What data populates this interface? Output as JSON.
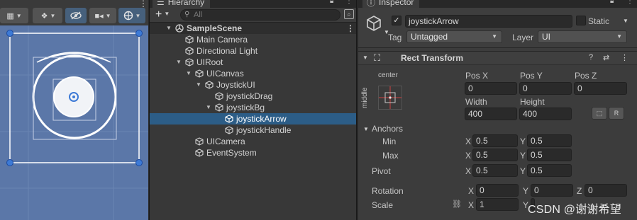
{
  "scene_toolbar": {
    "buttons": [
      "draw-mode",
      "fx",
      "gizmos",
      "visibility",
      "camera",
      "tools"
    ],
    "colors": {
      "bg": "#5b77a8",
      "handle": "#3d7ad6"
    }
  },
  "hierarchy": {
    "tab_title": "Hierarchy",
    "add_label": "+",
    "search_placeholder": "All",
    "items": [
      {
        "label": "SampleScene",
        "depth": 0,
        "icon": "unity-scene-icon",
        "expanded": true
      },
      {
        "label": "Main Camera",
        "depth": 1,
        "icon": "gameobject-icon"
      },
      {
        "label": "Directional Light",
        "depth": 1,
        "icon": "gameobject-icon"
      },
      {
        "label": "UIRoot",
        "depth": 1,
        "icon": "gameobject-icon",
        "expanded": true
      },
      {
        "label": "UICanvas",
        "depth": 2,
        "icon": "gameobject-icon",
        "expanded": true
      },
      {
        "label": "JoystickUI",
        "depth": 3,
        "icon": "gameobject-icon",
        "expanded": true
      },
      {
        "label": "joystickDrag",
        "depth": 4,
        "icon": "gameobject-icon"
      },
      {
        "label": "joystickBg",
        "depth": 4,
        "icon": "gameobject-icon",
        "expanded": true
      },
      {
        "label": "joystickArrow",
        "depth": 5,
        "icon": "gameobject-icon",
        "selected": true
      },
      {
        "label": "joystickHandle",
        "depth": 5,
        "icon": "gameobject-icon"
      },
      {
        "label": "UICamera",
        "depth": 2,
        "icon": "gameobject-icon"
      },
      {
        "label": "EventSystem",
        "depth": 2,
        "icon": "gameobject-icon"
      }
    ]
  },
  "inspector": {
    "tab_title": "Inspector",
    "object_name": "joystickArrow",
    "static_label": "Static",
    "tag_label": "Tag",
    "tag_value": "Untagged",
    "layer_label": "Layer",
    "layer_value": "UI",
    "component_title": "Rect Transform",
    "anchor_h": "center",
    "anchor_v": "middle",
    "pos_x_label": "Pos X",
    "pos_y_label": "Pos Y",
    "pos_z_label": "Pos Z",
    "pos_x": "0",
    "pos_y": "0",
    "pos_z": "0",
    "width_label": "Width",
    "height_label": "Height",
    "width": "400",
    "height": "400",
    "r_label": "R",
    "anchors_label": "Anchors",
    "min_label": "Min",
    "max_label": "Max",
    "min_x": "0.5",
    "min_y": "0.5",
    "max_x": "0.5",
    "max_y": "0.5",
    "pivot_label": "Pivot",
    "pivot_x": "0.5",
    "pivot_y": "0.5",
    "rotation_label": "Rotation",
    "rot_x": "0",
    "rot_y": "0",
    "rot_z": "0",
    "scale_label": "Scale",
    "scale_x": "1",
    "scale_y": "1",
    "x_letter": "X",
    "y_letter": "Y",
    "z_letter": "Z"
  },
  "watermark": "CSDN @谢谢希望"
}
